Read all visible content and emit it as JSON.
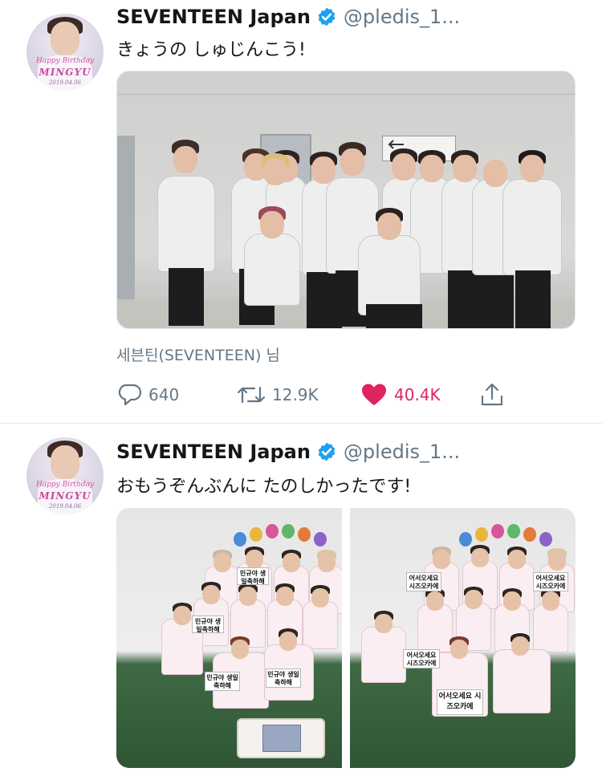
{
  "tweets": [
    {
      "author": {
        "name": "SEVENTEEN Japan",
        "handle": "@pledis_1...",
        "avatar_text": [
          "Happy Birthday",
          "MINGYU",
          "2019.04.06"
        ]
      },
      "text": "きょうの しゅじんこう!",
      "attribution": "세븐틴(SEVENTEEN) 님",
      "actions": {
        "reply_count": "640",
        "retweet_count": "12.9K",
        "like_count": "40.4K",
        "liked": true
      }
    },
    {
      "author": {
        "name": "SEVENTEEN Japan",
        "handle": "@pledis_1...",
        "avatar_text": [
          "Happy Birthday",
          "MINGYU",
          "2019.04.06"
        ]
      },
      "text": "おもうぞんぶんに たのしかったです!",
      "photo_cards": {
        "left": [
          "민규야 생일축하해",
          "민규야 생일축하해",
          "민규야 생일축하해",
          "민규야 생일축하해"
        ],
        "right": [
          "어서오세요 시즈오카에",
          "어서오세요 시즈오카에",
          "어서오세요 시즈오카에",
          "어서오세요 시즈오카에"
        ]
      }
    }
  ],
  "colors": {
    "verified": "#1da1f2",
    "like": "#e0245e",
    "secondary_text": "#657786",
    "divider": "#e1e8ed"
  },
  "icons": [
    "verified-badge-icon",
    "reply-icon",
    "retweet-icon",
    "like-heart-icon",
    "share-icon"
  ]
}
